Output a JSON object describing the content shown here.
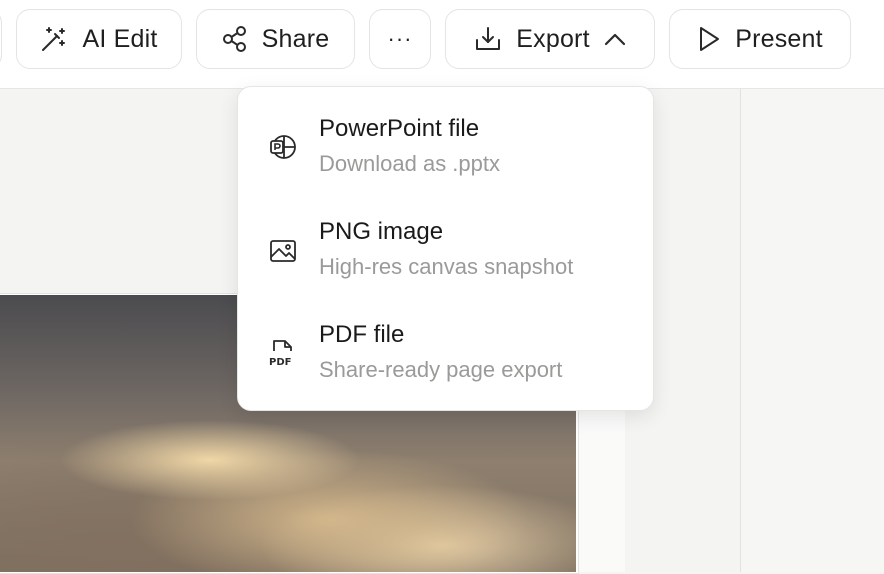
{
  "toolbar": {
    "ai_edit_label": "AI Edit",
    "share_label": "Share",
    "more_label": "···",
    "export_label": "Export",
    "present_label": "Present"
  },
  "export_menu": {
    "items": [
      {
        "title": "PowerPoint file",
        "subtitle": "Download as .pptx",
        "icon": "powerpoint-icon"
      },
      {
        "title": "PNG image",
        "subtitle": "High-res canvas snapshot",
        "icon": "image-icon"
      },
      {
        "title": "PDF file",
        "subtitle": "Share-ready page export",
        "icon": "pdf-file-icon",
        "icon_text": "PDF"
      }
    ]
  },
  "colors": {
    "accent_text": "#1f1f1f",
    "muted_text": "#9a9a98",
    "border": "#e4e4e2"
  }
}
